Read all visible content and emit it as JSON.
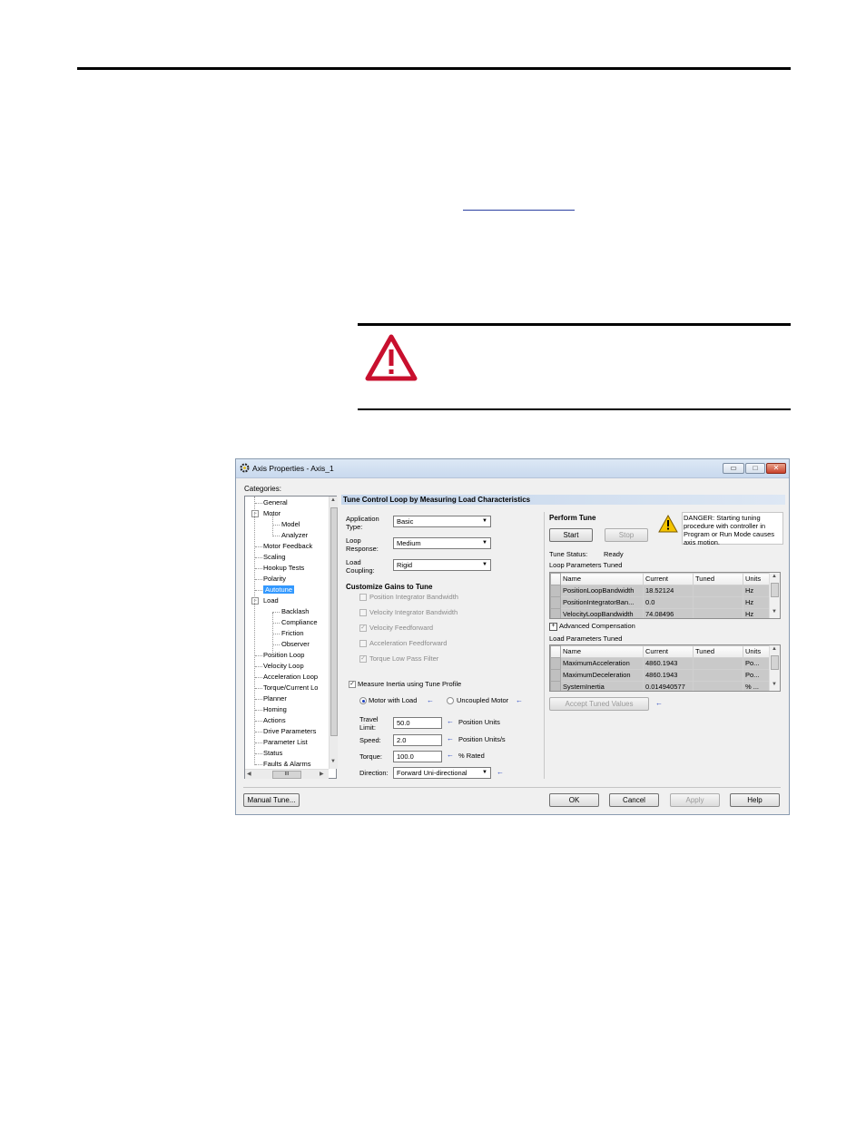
{
  "dialog": {
    "title": "Axis Properties - Axis_1",
    "window_buttons": {
      "minimize": "▭",
      "maximize": "□",
      "close": "✕"
    },
    "categories_label": "Categories:",
    "tree": [
      {
        "label": "General"
      },
      {
        "label": "Motor",
        "expander": "−"
      },
      {
        "label": "Model"
      },
      {
        "label": "Analyzer"
      },
      {
        "label": "Motor Feedback"
      },
      {
        "label": "Scaling"
      },
      {
        "label": "Hookup Tests"
      },
      {
        "label": "Polarity"
      },
      {
        "label": "Autotune",
        "selected": true
      },
      {
        "label": "Load",
        "expander": "−"
      },
      {
        "label": "Backlash"
      },
      {
        "label": "Compliance"
      },
      {
        "label": "Friction"
      },
      {
        "label": "Observer"
      },
      {
        "label": "Position Loop"
      },
      {
        "label": "Velocity Loop"
      },
      {
        "label": "Acceleration Loop"
      },
      {
        "label": "Torque/Current Lo"
      },
      {
        "label": "Planner"
      },
      {
        "label": "Homing"
      },
      {
        "label": "Actions"
      },
      {
        "label": "Drive Parameters"
      },
      {
        "label": "Parameter List"
      },
      {
        "label": "Status"
      },
      {
        "label": "Faults & Alarms"
      }
    ],
    "tree_hscroll_label": "III",
    "section_title": "Tune Control Loop by Measuring Load Characteristics",
    "application_type": {
      "label1": "Application",
      "label2": "Type:",
      "value": "Basic"
    },
    "loop_response": {
      "label1": "Loop",
      "label2": "Response:",
      "value": "Medium"
    },
    "load_coupling": {
      "label1": "Load",
      "label2": "Coupling:",
      "value": "Rigid"
    },
    "customize_title": "Customize Gains to Tune",
    "gains": [
      {
        "label": "Position Integrator Bandwidth",
        "checked": false
      },
      {
        "label": "Velocity Integrator Bandwidth",
        "checked": false
      },
      {
        "label": "Velocity Feedforward",
        "checked": true
      },
      {
        "label": "Acceleration Feedforward",
        "checked": false
      },
      {
        "label": "Torque Low Pass Filter",
        "checked": true
      }
    ],
    "measure_inertia": {
      "label": "Measure Inertia using Tune Profile",
      "checked": true
    },
    "motor_with_load": "Motor with Load",
    "uncoupled_motor": "Uncoupled Motor",
    "travel_limit": {
      "label1": "Travel",
      "label2": "Limit:",
      "value": "50.0",
      "units": "Position Units"
    },
    "speed": {
      "label": "Speed:",
      "value": "2.0",
      "units": "Position Units/s"
    },
    "torque": {
      "label": "Torque:",
      "value": "100.0",
      "units": "% Rated"
    },
    "direction": {
      "label": "Direction:",
      "value": "Forward Uni-directional"
    },
    "perform_tune": "Perform Tune",
    "start_btn": "Start",
    "stop_btn": "Stop",
    "danger_text": [
      "DANGER: Starting tuning",
      "procedure with controller in",
      "Program or Run Mode causes",
      "axis motion."
    ],
    "tune_status_label": "Tune Status:",
    "tune_status_value": "Ready",
    "loop_params_title": "Loop Parameters Tuned",
    "grid_headers": [
      "Name",
      "Current",
      "Tuned",
      "Units"
    ],
    "loop_params": [
      {
        "name": "PositionLoopBandwidth",
        "current": "18.52124",
        "tuned": "",
        "units": "Hz"
      },
      {
        "name": "PositionIntegratorBan...",
        "current": "0.0",
        "tuned": "",
        "units": "Hz"
      },
      {
        "name": "VelocityLoopBandwidth",
        "current": "74.08496",
        "tuned": "",
        "units": "Hz"
      }
    ],
    "advanced_comp": "Advanced Compensation",
    "load_params_title": "Load Parameters Tuned",
    "load_params": [
      {
        "name": "MaximumAcceleration",
        "current": "4860.1943",
        "tuned": "",
        "units": "Po..."
      },
      {
        "name": "MaximumDeceleration",
        "current": "4860.1943",
        "tuned": "",
        "units": "Po..."
      },
      {
        "name": "SystemInertia",
        "current": "0.014940577",
        "tuned": "",
        "units": "% ..."
      }
    ],
    "accept_btn": "Accept Tuned Values",
    "manual_tune_btn": "Manual Tune...",
    "ok_btn": "OK",
    "cancel_btn": "Cancel",
    "apply_btn": "Apply",
    "help_btn": "Help"
  }
}
